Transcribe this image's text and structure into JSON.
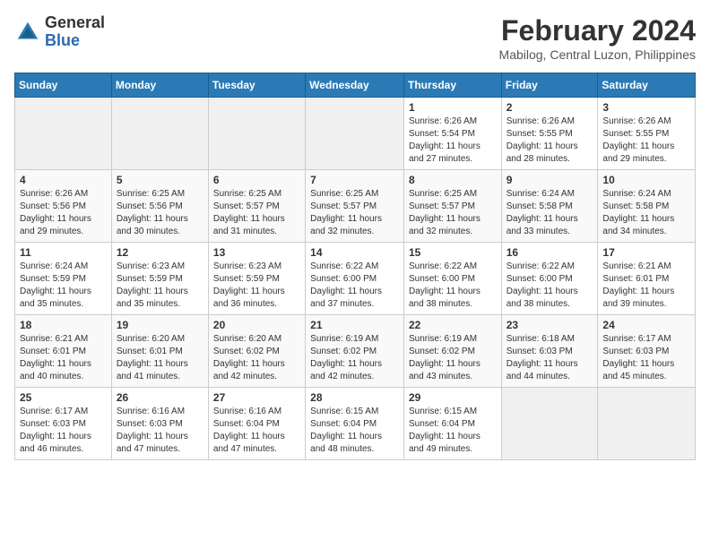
{
  "logo": {
    "general": "General",
    "blue": "Blue"
  },
  "title": {
    "month_year": "February 2024",
    "location": "Mabilog, Central Luzon, Philippines"
  },
  "days_of_week": [
    "Sunday",
    "Monday",
    "Tuesday",
    "Wednesday",
    "Thursday",
    "Friday",
    "Saturday"
  ],
  "weeks": [
    [
      {
        "day": "",
        "info": ""
      },
      {
        "day": "",
        "info": ""
      },
      {
        "day": "",
        "info": ""
      },
      {
        "day": "",
        "info": ""
      },
      {
        "day": "1",
        "info": "Sunrise: 6:26 AM\nSunset: 5:54 PM\nDaylight: 11 hours\nand 27 minutes."
      },
      {
        "day": "2",
        "info": "Sunrise: 6:26 AM\nSunset: 5:55 PM\nDaylight: 11 hours\nand 28 minutes."
      },
      {
        "day": "3",
        "info": "Sunrise: 6:26 AM\nSunset: 5:55 PM\nDaylight: 11 hours\nand 29 minutes."
      }
    ],
    [
      {
        "day": "4",
        "info": "Sunrise: 6:26 AM\nSunset: 5:56 PM\nDaylight: 11 hours\nand 29 minutes."
      },
      {
        "day": "5",
        "info": "Sunrise: 6:25 AM\nSunset: 5:56 PM\nDaylight: 11 hours\nand 30 minutes."
      },
      {
        "day": "6",
        "info": "Sunrise: 6:25 AM\nSunset: 5:57 PM\nDaylight: 11 hours\nand 31 minutes."
      },
      {
        "day": "7",
        "info": "Sunrise: 6:25 AM\nSunset: 5:57 PM\nDaylight: 11 hours\nand 32 minutes."
      },
      {
        "day": "8",
        "info": "Sunrise: 6:25 AM\nSunset: 5:57 PM\nDaylight: 11 hours\nand 32 minutes."
      },
      {
        "day": "9",
        "info": "Sunrise: 6:24 AM\nSunset: 5:58 PM\nDaylight: 11 hours\nand 33 minutes."
      },
      {
        "day": "10",
        "info": "Sunrise: 6:24 AM\nSunset: 5:58 PM\nDaylight: 11 hours\nand 34 minutes."
      }
    ],
    [
      {
        "day": "11",
        "info": "Sunrise: 6:24 AM\nSunset: 5:59 PM\nDaylight: 11 hours\nand 35 minutes."
      },
      {
        "day": "12",
        "info": "Sunrise: 6:23 AM\nSunset: 5:59 PM\nDaylight: 11 hours\nand 35 minutes."
      },
      {
        "day": "13",
        "info": "Sunrise: 6:23 AM\nSunset: 5:59 PM\nDaylight: 11 hours\nand 36 minutes."
      },
      {
        "day": "14",
        "info": "Sunrise: 6:22 AM\nSunset: 6:00 PM\nDaylight: 11 hours\nand 37 minutes."
      },
      {
        "day": "15",
        "info": "Sunrise: 6:22 AM\nSunset: 6:00 PM\nDaylight: 11 hours\nand 38 minutes."
      },
      {
        "day": "16",
        "info": "Sunrise: 6:22 AM\nSunset: 6:00 PM\nDaylight: 11 hours\nand 38 minutes."
      },
      {
        "day": "17",
        "info": "Sunrise: 6:21 AM\nSunset: 6:01 PM\nDaylight: 11 hours\nand 39 minutes."
      }
    ],
    [
      {
        "day": "18",
        "info": "Sunrise: 6:21 AM\nSunset: 6:01 PM\nDaylight: 11 hours\nand 40 minutes."
      },
      {
        "day": "19",
        "info": "Sunrise: 6:20 AM\nSunset: 6:01 PM\nDaylight: 11 hours\nand 41 minutes."
      },
      {
        "day": "20",
        "info": "Sunrise: 6:20 AM\nSunset: 6:02 PM\nDaylight: 11 hours\nand 42 minutes."
      },
      {
        "day": "21",
        "info": "Sunrise: 6:19 AM\nSunset: 6:02 PM\nDaylight: 11 hours\nand 42 minutes."
      },
      {
        "day": "22",
        "info": "Sunrise: 6:19 AM\nSunset: 6:02 PM\nDaylight: 11 hours\nand 43 minutes."
      },
      {
        "day": "23",
        "info": "Sunrise: 6:18 AM\nSunset: 6:03 PM\nDaylight: 11 hours\nand 44 minutes."
      },
      {
        "day": "24",
        "info": "Sunrise: 6:17 AM\nSunset: 6:03 PM\nDaylight: 11 hours\nand 45 minutes."
      }
    ],
    [
      {
        "day": "25",
        "info": "Sunrise: 6:17 AM\nSunset: 6:03 PM\nDaylight: 11 hours\nand 46 minutes."
      },
      {
        "day": "26",
        "info": "Sunrise: 6:16 AM\nSunset: 6:03 PM\nDaylight: 11 hours\nand 47 minutes."
      },
      {
        "day": "27",
        "info": "Sunrise: 6:16 AM\nSunset: 6:04 PM\nDaylight: 11 hours\nand 47 minutes."
      },
      {
        "day": "28",
        "info": "Sunrise: 6:15 AM\nSunset: 6:04 PM\nDaylight: 11 hours\nand 48 minutes."
      },
      {
        "day": "29",
        "info": "Sunrise: 6:15 AM\nSunset: 6:04 PM\nDaylight: 11 hours\nand 49 minutes."
      },
      {
        "day": "",
        "info": ""
      },
      {
        "day": "",
        "info": ""
      }
    ]
  ]
}
